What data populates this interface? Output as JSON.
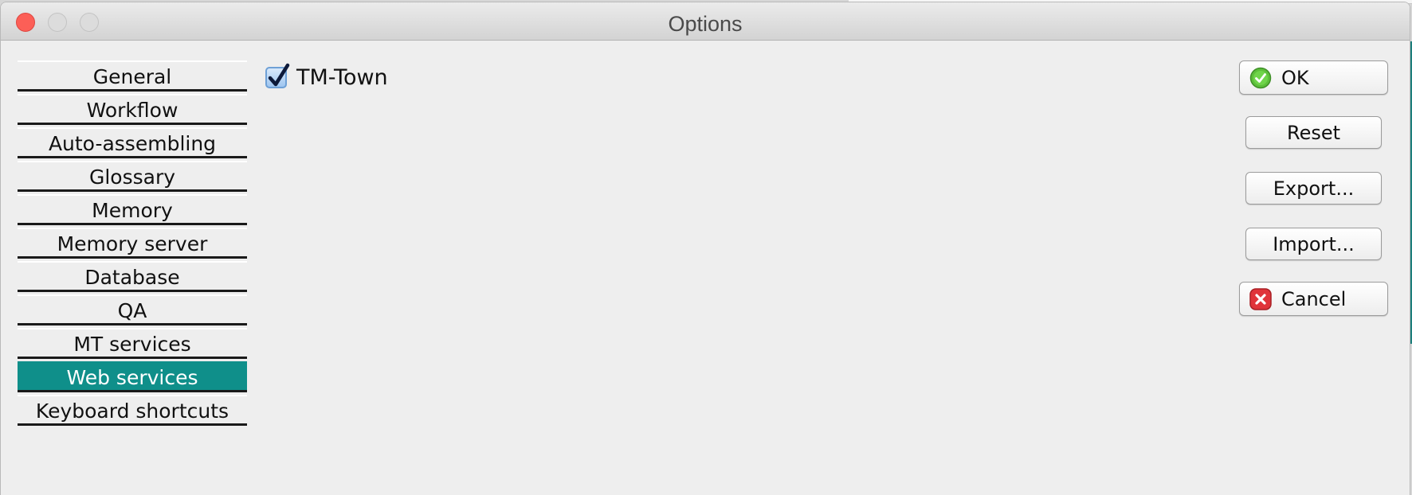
{
  "window": {
    "title": "Options"
  },
  "titlebar_icons": [
    "close-icon",
    "minimize-icon",
    "zoom-icon"
  ],
  "sidebar": {
    "items": [
      {
        "label": "General",
        "selected": false
      },
      {
        "label": "Workflow",
        "selected": false
      },
      {
        "label": "Auto-assembling",
        "selected": false
      },
      {
        "label": "Glossary",
        "selected": false
      },
      {
        "label": "Memory",
        "selected": false
      },
      {
        "label": "Memory server",
        "selected": false
      },
      {
        "label": "Database",
        "selected": false
      },
      {
        "label": "QA",
        "selected": false
      },
      {
        "label": "MT services",
        "selected": false
      },
      {
        "label": "Web services",
        "selected": true
      },
      {
        "label": "Keyboard shortcuts",
        "selected": false
      }
    ],
    "selected_color": "#0f8f8a"
  },
  "web_services": {
    "tmtown": {
      "label": "TM-Town",
      "checked": true
    }
  },
  "buttons": {
    "ok": {
      "label": "OK",
      "icon": "check-circle-icon"
    },
    "reset": {
      "label": "Reset"
    },
    "export": {
      "label": "Export..."
    },
    "import": {
      "label": "Import..."
    },
    "cancel": {
      "label": "Cancel",
      "icon": "close-x-icon"
    }
  }
}
